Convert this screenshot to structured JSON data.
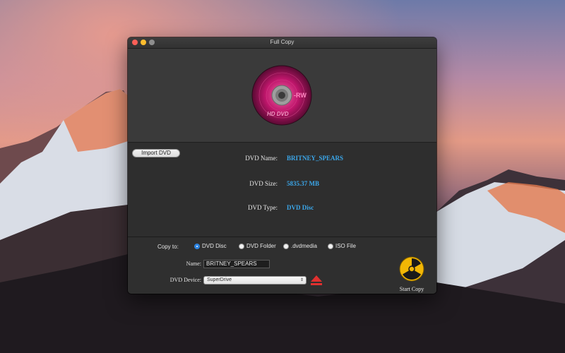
{
  "window": {
    "title": "Full Copy"
  },
  "disc": {
    "badge": "-RW",
    "logo_text": "HD DVD"
  },
  "import_button": {
    "label": "Import DVD"
  },
  "info": {
    "name_label": "DVD Name:",
    "name_value": "BRITNEY_SPEARS",
    "size_label": "DVD Size:",
    "size_value": "5835.37 MB",
    "type_label": "DVD Type:",
    "type_value": "DVD Disc"
  },
  "copy_to": {
    "label": "Copy to:",
    "options": [
      {
        "label": "DVD Disc",
        "selected": true
      },
      {
        "label": "DVD Folder",
        "selected": false
      },
      {
        "label": ".dvdmedia",
        "selected": false
      },
      {
        "label": "ISO File",
        "selected": false
      }
    ]
  },
  "name_field": {
    "label": "Name:",
    "value": "BRITNEY_SPEARS"
  },
  "device": {
    "label": "DVD Device:",
    "selected": "SuperDrive"
  },
  "start": {
    "label": "Start Copy"
  },
  "colors": {
    "accent": "#3ba7ea",
    "disc": "#c0166c",
    "eject": "#e0302f",
    "start": "#f2b705"
  }
}
